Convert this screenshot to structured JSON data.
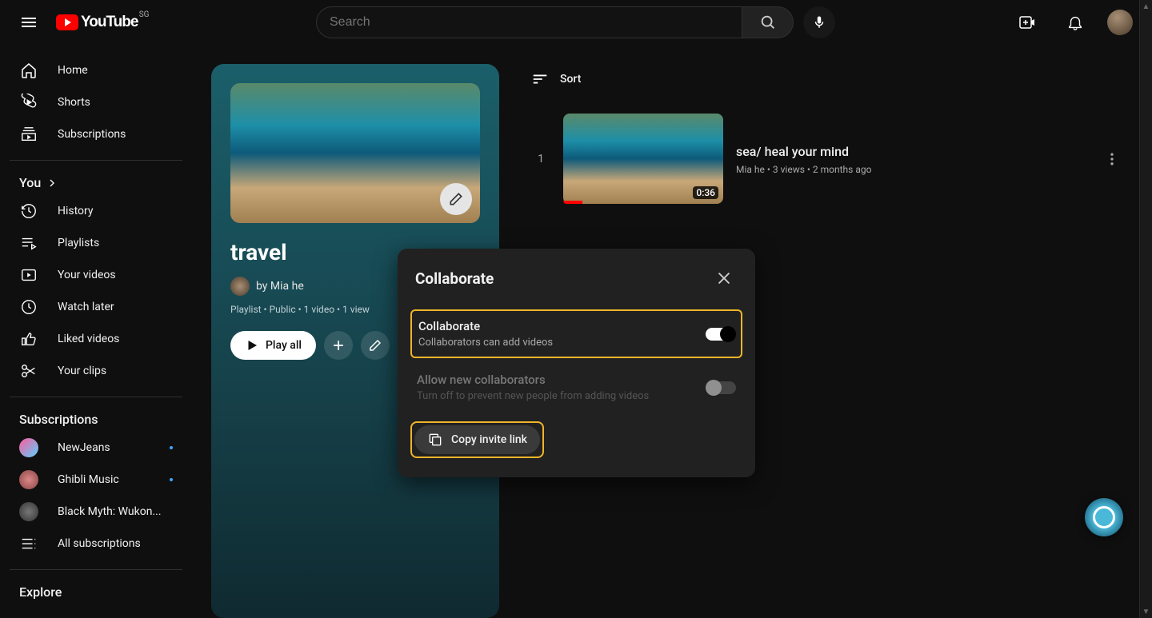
{
  "header": {
    "logo_text": "YouTube",
    "region": "SG",
    "search_placeholder": "Search"
  },
  "sidebar": {
    "primary": [
      {
        "label": "Home",
        "icon": "home"
      },
      {
        "label": "Shorts",
        "icon": "shorts"
      },
      {
        "label": "Subscriptions",
        "icon": "subscriptions"
      }
    ],
    "you_header": "You",
    "you": [
      {
        "label": "History",
        "icon": "history"
      },
      {
        "label": "Playlists",
        "icon": "playlists"
      },
      {
        "label": "Your videos",
        "icon": "your-videos"
      },
      {
        "label": "Watch later",
        "icon": "watch-later"
      },
      {
        "label": "Liked videos",
        "icon": "liked"
      },
      {
        "label": "Your clips",
        "icon": "clips"
      }
    ],
    "subs_header": "Subscriptions",
    "subs": [
      {
        "label": "NewJeans",
        "dot": true,
        "color": "linear-gradient(135deg,#ff5a9e,#5ad1ff)"
      },
      {
        "label": "Ghibli Music",
        "dot": true,
        "color": "radial-gradient(circle,#d88,#844)"
      },
      {
        "label": "Black Myth: Wukon...",
        "dot": false,
        "color": "radial-gradient(circle,#777,#333)"
      }
    ],
    "all_subs": "All subscriptions",
    "explore_header": "Explore"
  },
  "playlist": {
    "title": "travel",
    "by_prefix": "by",
    "owner": "Mia he",
    "meta": "Playlist • Public • 1 video • 1 view",
    "play_all": "Play all"
  },
  "sort_label": "Sort",
  "videos": [
    {
      "index": "1",
      "title": "sea/ heal your mind",
      "meta": "Mia he • 3 views • 2 months ago",
      "duration": "0:36"
    }
  ],
  "dialog": {
    "title": "Collaborate",
    "opt1_label": "Collaborate",
    "opt1_sub": "Collaborators can add videos",
    "opt1_on": true,
    "opt2_label": "Allow new collaborators",
    "opt2_sub": "Turn off to prevent new people from adding videos",
    "opt2_on": false,
    "copy_label": "Copy invite link"
  }
}
